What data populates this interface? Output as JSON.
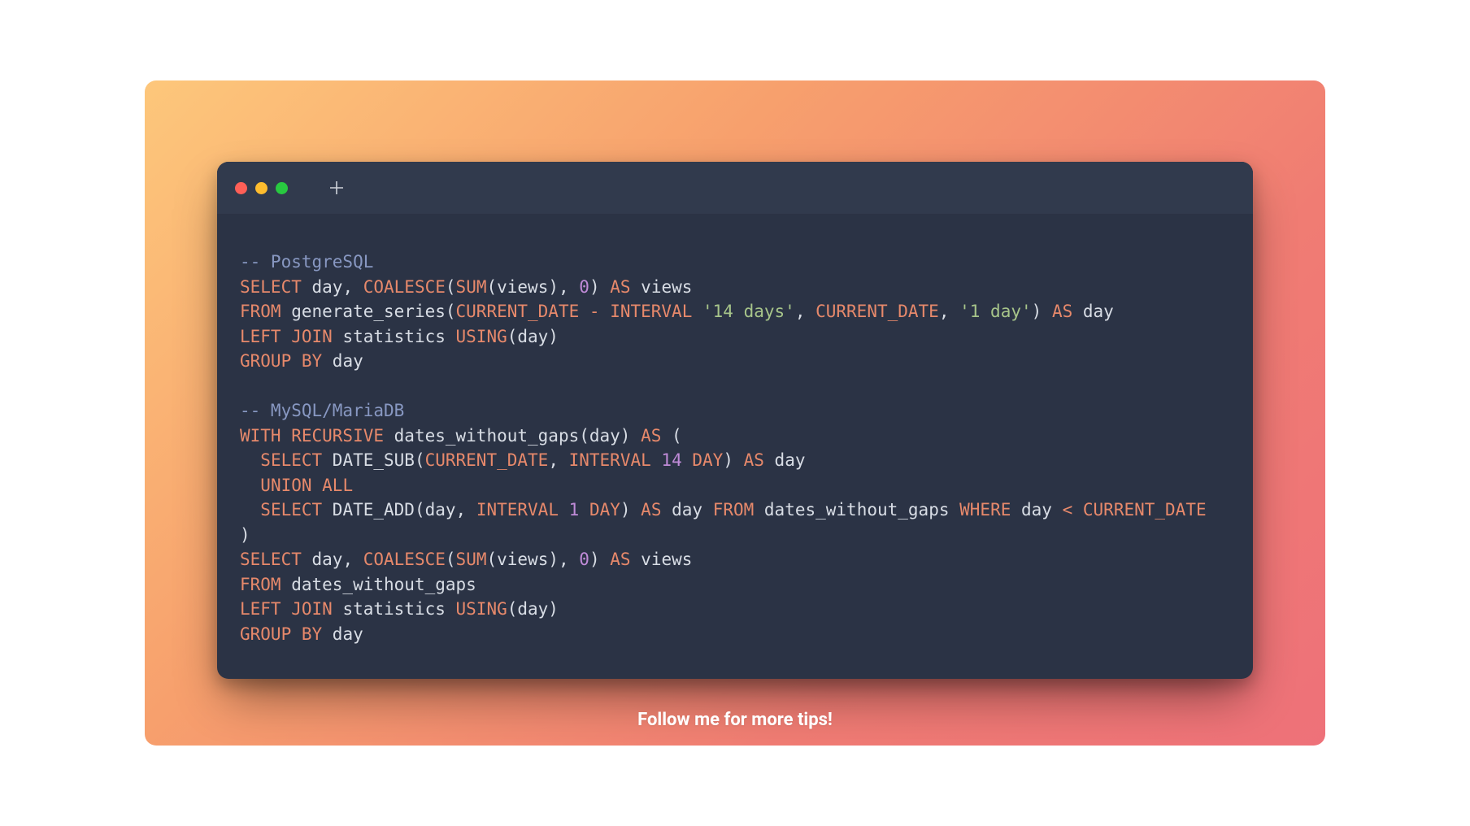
{
  "footer": {
    "text": "Follow me for more tips!"
  },
  "traffic_lights": {
    "close": "#ff5f57",
    "minimize": "#febc2e",
    "zoom": "#28c840"
  },
  "code": {
    "tokens": [
      [
        {
          "t": "cmt",
          "v": "-- PostgreSQL"
        }
      ],
      [
        {
          "t": "kw",
          "v": "SELECT"
        },
        {
          "t": "id",
          "v": " day"
        },
        {
          "t": "op",
          "v": ", "
        },
        {
          "t": "fn",
          "v": "COALESCE"
        },
        {
          "t": "op",
          "v": "("
        },
        {
          "t": "fn",
          "v": "SUM"
        },
        {
          "t": "op",
          "v": "(views), "
        },
        {
          "t": "num",
          "v": "0"
        },
        {
          "t": "op",
          "v": ") "
        },
        {
          "t": "kw",
          "v": "AS"
        },
        {
          "t": "id",
          "v": " views"
        }
      ],
      [
        {
          "t": "kw",
          "v": "FROM"
        },
        {
          "t": "id",
          "v": " generate_series("
        },
        {
          "t": "fn",
          "v": "CURRENT_DATE"
        },
        {
          "t": "op",
          "v": " "
        },
        {
          "t": "kw",
          "v": "-"
        },
        {
          "t": "op",
          "v": " "
        },
        {
          "t": "kw",
          "v": "INTERVAL"
        },
        {
          "t": "op",
          "v": " "
        },
        {
          "t": "str",
          "v": "'14 days'"
        },
        {
          "t": "op",
          "v": ", "
        },
        {
          "t": "fn",
          "v": "CURRENT_DATE"
        },
        {
          "t": "op",
          "v": ", "
        },
        {
          "t": "str",
          "v": "'1 day'"
        },
        {
          "t": "op",
          "v": ") "
        },
        {
          "t": "kw",
          "v": "AS"
        },
        {
          "t": "id",
          "v": " day"
        }
      ],
      [
        {
          "t": "kw",
          "v": "LEFT JOIN"
        },
        {
          "t": "id",
          "v": " statistics "
        },
        {
          "t": "fn",
          "v": "USING"
        },
        {
          "t": "op",
          "v": "(day)"
        }
      ],
      [
        {
          "t": "kw",
          "v": "GROUP BY"
        },
        {
          "t": "id",
          "v": " day"
        }
      ],
      [],
      [
        {
          "t": "cmt",
          "v": "-- MySQL/MariaDB"
        }
      ],
      [
        {
          "t": "kw",
          "v": "WITH RECURSIVE"
        },
        {
          "t": "id",
          "v": " dates_without_gaps(day) "
        },
        {
          "t": "kw",
          "v": "AS"
        },
        {
          "t": "op",
          "v": " ("
        }
      ],
      [
        {
          "t": "op",
          "v": "  "
        },
        {
          "t": "kw",
          "v": "SELECT"
        },
        {
          "t": "id",
          "v": " DATE_SUB("
        },
        {
          "t": "fn",
          "v": "CURRENT_DATE"
        },
        {
          "t": "op",
          "v": ", "
        },
        {
          "t": "kw",
          "v": "INTERVAL"
        },
        {
          "t": "op",
          "v": " "
        },
        {
          "t": "num",
          "v": "14"
        },
        {
          "t": "op",
          "v": " "
        },
        {
          "t": "kw",
          "v": "DAY"
        },
        {
          "t": "op",
          "v": ") "
        },
        {
          "t": "kw",
          "v": "AS"
        },
        {
          "t": "id",
          "v": " day"
        }
      ],
      [
        {
          "t": "op",
          "v": "  "
        },
        {
          "t": "kw",
          "v": "UNION ALL"
        }
      ],
      [
        {
          "t": "op",
          "v": "  "
        },
        {
          "t": "kw",
          "v": "SELECT"
        },
        {
          "t": "id",
          "v": " DATE_ADD(day, "
        },
        {
          "t": "kw",
          "v": "INTERVAL"
        },
        {
          "t": "op",
          "v": " "
        },
        {
          "t": "num",
          "v": "1"
        },
        {
          "t": "op",
          "v": " "
        },
        {
          "t": "kw",
          "v": "DAY"
        },
        {
          "t": "op",
          "v": ") "
        },
        {
          "t": "kw",
          "v": "AS"
        },
        {
          "t": "id",
          "v": " day "
        },
        {
          "t": "kw",
          "v": "FROM"
        },
        {
          "t": "id",
          "v": " dates_without_gaps "
        },
        {
          "t": "kw",
          "v": "WHERE"
        },
        {
          "t": "id",
          "v": " day "
        },
        {
          "t": "kw",
          "v": "<"
        },
        {
          "t": "op",
          "v": " "
        },
        {
          "t": "fn",
          "v": "CURRENT_DATE"
        }
      ],
      [
        {
          "t": "op",
          "v": ")"
        }
      ],
      [
        {
          "t": "kw",
          "v": "SELECT"
        },
        {
          "t": "id",
          "v": " day"
        },
        {
          "t": "op",
          "v": ", "
        },
        {
          "t": "fn",
          "v": "COALESCE"
        },
        {
          "t": "op",
          "v": "("
        },
        {
          "t": "fn",
          "v": "SUM"
        },
        {
          "t": "op",
          "v": "(views), "
        },
        {
          "t": "num",
          "v": "0"
        },
        {
          "t": "op",
          "v": ") "
        },
        {
          "t": "kw",
          "v": "AS"
        },
        {
          "t": "id",
          "v": " views"
        }
      ],
      [
        {
          "t": "kw",
          "v": "FROM"
        },
        {
          "t": "id",
          "v": " dates_without_gaps"
        }
      ],
      [
        {
          "t": "kw",
          "v": "LEFT JOIN"
        },
        {
          "t": "id",
          "v": " statistics "
        },
        {
          "t": "fn",
          "v": "USING"
        },
        {
          "t": "op",
          "v": "(day)"
        }
      ],
      [
        {
          "t": "kw",
          "v": "GROUP BY"
        },
        {
          "t": "id",
          "v": " day"
        }
      ]
    ]
  }
}
